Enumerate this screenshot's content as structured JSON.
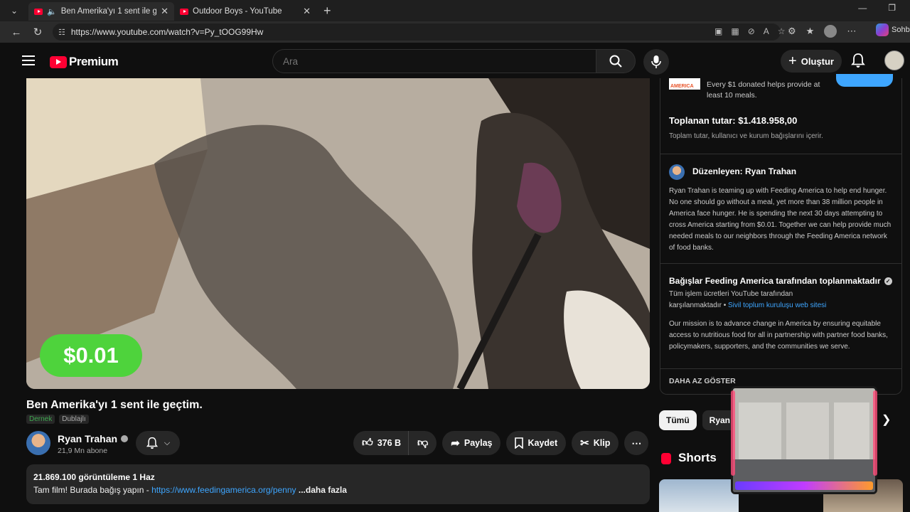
{
  "browser": {
    "tabs": [
      {
        "title": "Ben Amerika'yı 1 sent ile geçtim.",
        "active": true
      },
      {
        "title": "Outdoor Boys - YouTube",
        "active": false
      }
    ],
    "url": "https://www.youtube.com/watch?v=Py_tOOG99Hw",
    "copilot_label": "Sohb"
  },
  "header": {
    "logo_text": "Premium",
    "search_placeholder": "Ara",
    "create_label": "Oluştur"
  },
  "video": {
    "overlay_price": "$0.01"
  },
  "details": {
    "title": "Ben Amerika'yı 1 sent ile geçtim.",
    "badges": [
      "Dernek",
      "Dublajlı"
    ],
    "channel_name": "Ryan Trahan",
    "subscribers": "21,9 Mn abone",
    "likes": "376 B",
    "share_label": "Paylaş",
    "save_label": "Kaydet",
    "clip_label": "Klip",
    "views_date": "21.869.100 görüntüleme  1 Haz",
    "desc_prefix": "Tam film! Burada bağış yapın - ",
    "desc_link": "https://www.feedingamerica.org/penny",
    "desc_more": " ...daha fazla"
  },
  "fundraiser": {
    "fa_logo": "AMERICA",
    "donate_text": "Every $1 donated helps provide at least 10 meals.",
    "total": "Toplanan tutar: $1.418.958,00",
    "total_sub": "Toplam tutar, kullanıcı ve kurum bağışlarını içerir.",
    "organizer": "Düzenleyen: Ryan Trahan",
    "organizer_text": "Ryan Trahan is teaming up with Feeding America to help end hunger. No one should go without a meal, yet more than 38 million people in America face hunger. He is spending the next 30 days attempting to cross America starting from $0.01. Together we can help provide much needed meals to our neighbors through the Feeding America network of food banks.",
    "collected_by": "Bağışlar Feeding America tarafından toplanmaktadır",
    "fees_text": "Tüm işlem ücretleri YouTube tarafından karşılanmaktadır",
    "bullet": " • ",
    "site_link": "Sivil toplum kuruluşu web sitesi",
    "mission": "Our mission is to advance change in America by ensuring equitable access to nutritious food for all in partnership with partner food banks, policymakers, supporters, and the communities we serve.",
    "show_less": "DAHA AZ GÖSTER"
  },
  "sidebar": {
    "chips": [
      "Tümü",
      "Ryan"
    ],
    "shorts_title": "Shorts"
  },
  "colors": {
    "accent": "#ff0033",
    "link": "#3ea6ff",
    "price_badge": "#4ed33c"
  }
}
